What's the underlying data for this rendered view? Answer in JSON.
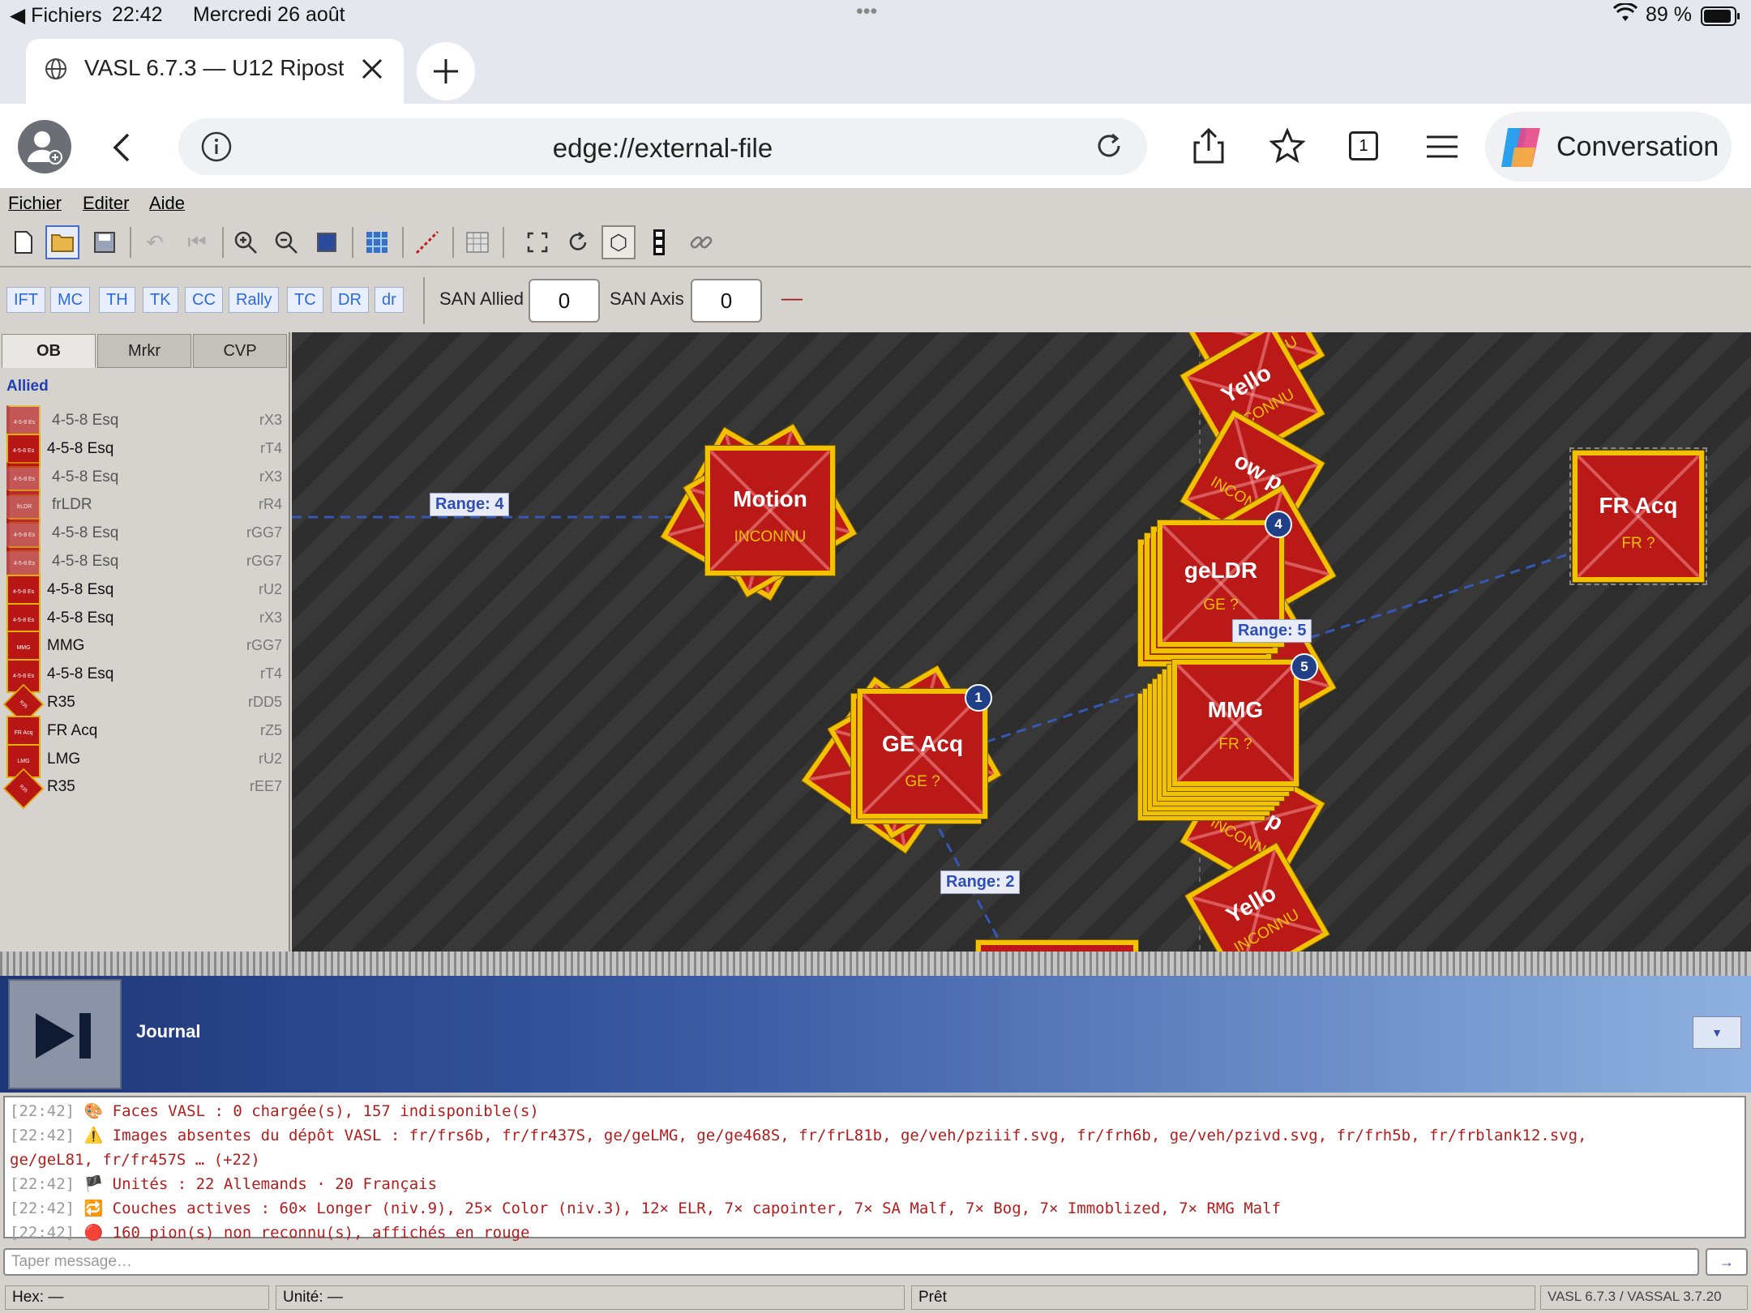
{
  "ios_status": {
    "files_label": "Fichiers",
    "time": "22:42",
    "date": "Mercredi 26 août",
    "battery": "89 %",
    "dots": "•••"
  },
  "browser": {
    "tab_title": "VASL 6.7.3 — U12 Riposte",
    "url": "edge://external-file",
    "tab_count": "1",
    "copilot_label": "Conversation"
  },
  "menu": {
    "file": "Fichier",
    "edit": "Editer",
    "help": "Aide"
  },
  "dice_buttons": [
    "IFT",
    "MC",
    "TH",
    "TK",
    "CC",
    "Rally",
    "TC",
    "DR",
    "dr"
  ],
  "san": {
    "allied_label": "SAN Allied",
    "allied_value": "0",
    "axis_label": "SAN Axis",
    "axis_value": "0",
    "dash": "—"
  },
  "left_panel": {
    "tabs": [
      "OB",
      "Mrkr",
      "CVP"
    ],
    "section": "Allied",
    "units": [
      {
        "name": "4-5-8 Esq",
        "loc": "rX3",
        "chit": "4-5-8 Es"
      },
      {
        "name": "4-5-8 Esq",
        "loc": "rT4",
        "chit": "4-5-8 Es"
      },
      {
        "name": "4-5-8 Esq",
        "loc": "rX3",
        "chit": "4-5-8 Es"
      },
      {
        "name": "frLDR",
        "loc": "rR4",
        "chit": "frLDR"
      },
      {
        "name": "4-5-8 Esq",
        "loc": "rGG7",
        "chit": "4-5-8 Es"
      },
      {
        "name": "4-5-8 Esq",
        "loc": "rGG7",
        "chit": "4-5-8 Es"
      },
      {
        "name": "4-5-8 Esq",
        "loc": "rU2",
        "chit": "4-5-8 Es"
      },
      {
        "name": "4-5-8 Esq",
        "loc": "rX3",
        "chit": "4-5-8 Es"
      },
      {
        "name": "MMG",
        "loc": "rGG7",
        "chit": "MMG"
      },
      {
        "name": "4-5-8 Esq",
        "loc": "rT4",
        "chit": "4-5-8 Es"
      },
      {
        "name": "R35",
        "loc": "rDD5",
        "chit": "R35"
      },
      {
        "name": "FR Acq",
        "loc": "rZ5",
        "chit": "FR Acq"
      },
      {
        "name": "LMG",
        "loc": "rU2",
        "chit": "LMG"
      },
      {
        "name": "R35",
        "loc": "rEE7",
        "chit": "R35"
      }
    ]
  },
  "map": {
    "counters": {
      "motion": {
        "big": "Motion",
        "small": "INCONNU"
      },
      "geldr": {
        "big": "geLDR",
        "small": "GE ?",
        "badge": "4"
      },
      "mmg": {
        "big": "MMG",
        "small": "FR ?",
        "badge": "5"
      },
      "geacq": {
        "big": "GE Acq",
        "small": "GE ?",
        "badge": "1"
      },
      "fracq": {
        "big": "FR Acq",
        "small": "FR ?"
      },
      "yellow_top": {
        "big": "Yello",
        "small": "INCONNU"
      },
      "yellow_p1": {
        "big": "ow p",
        "small": "INCONNU"
      },
      "yellow_p2": {
        "big": "ow p",
        "small": "INCONNU"
      },
      "yellow_bottom": {
        "big": "Yello",
        "small": "INCONNU"
      },
      "inconnu_top": {
        "small": "INCONNU"
      }
    },
    "ranges": {
      "r4": "Range: 4",
      "r5": "Range: 5",
      "r2": "Range: 2"
    }
  },
  "journal": {
    "title": "Journal",
    "dropdown": "▼"
  },
  "log": [
    {
      "ts": "[22:42]",
      "icon": "🎨",
      "text": "Faces VASL : 0 chargée(s), 157 indisponible(s)"
    },
    {
      "ts": "[22:42]",
      "icon": "⚠️",
      "text": "Images absentes du dépôt VASL : fr/frs6b, fr/fr437S, ge/geLMG, ge/ge468S, fr/frL81b, ge/veh/pziiif.svg, fr/frh6b, ge/veh/pzivd.svg, fr/frh5b, fr/frblank12.svg,",
      "cont": "ge/geL81, fr/fr457S … (+22)"
    },
    {
      "ts": "[22:42]",
      "icon": "🏴",
      "text": "Unités : 22 Allemands · 20 Français"
    },
    {
      "ts": "[22:42]",
      "icon": "🔁",
      "text": "Couches actives : 60× Longer (niv.9), 25× Color (niv.3), 12× ELR, 7× capointer, 7× SA Malf, 7× Bog, 7× Immoblized, 7× RMG Malf"
    },
    {
      "ts": "[22:42]",
      "icon": "🔴",
      "text": "160 pion(s) non reconnu(s), affichés en rouge"
    }
  ],
  "message": {
    "placeholder": "Taper message…",
    "send": "→"
  },
  "status": {
    "hex": "Hex: —",
    "unit": "Unité: —",
    "state": "Prêt",
    "version": "VASL 6.7.3 / VASSAL 3.7.20"
  },
  "colors": {
    "counter_red": "#bb1818",
    "counter_border": "#f2c200",
    "range_line": "#2e4fb5",
    "journal_dark": "#1e3677"
  }
}
